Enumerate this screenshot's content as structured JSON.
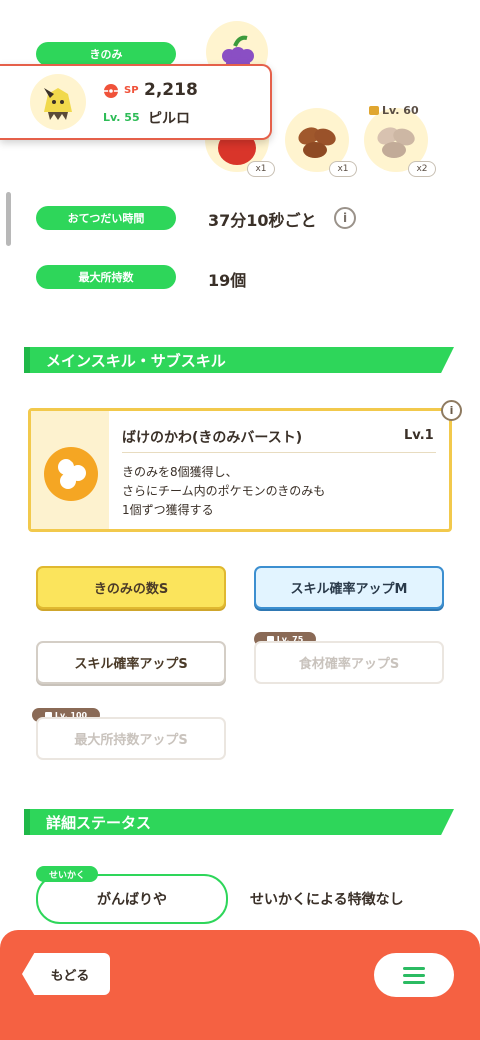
{
  "berry_section": {
    "label": "きのみ",
    "ingredients": [
      {
        "icon": "tomato-icon",
        "qty": "x1"
      },
      {
        "icon": "cacao-icon",
        "qty": "x1"
      },
      {
        "icon": "mushroom-icon",
        "qty": "x2",
        "lock_level": "Lv. 60"
      }
    ],
    "berry_icon": "grape-berry-icon"
  },
  "pokemon": {
    "sp_label": "SP",
    "sp_value": "2,218",
    "level": "Lv. 55",
    "name": "ピルロ"
  },
  "help_row": {
    "label": "おてつだい時間",
    "value": "37分10秒ごと"
  },
  "capacity_row": {
    "label": "最大所持数",
    "value": "19個"
  },
  "skills_section": {
    "title": "メインスキル・サブスキル"
  },
  "main_skill": {
    "name": "ばけのかわ(きのみバースト)",
    "level": "Lv.1",
    "description_lines": [
      "きのみを8個獲得し、",
      "さらにチーム内のポケモンのきのみも",
      "1個ずつ獲得する"
    ]
  },
  "sub_skills": [
    {
      "label": "きのみの数S",
      "style": "gold"
    },
    {
      "label": "スキル確率アップM",
      "style": "blue"
    },
    {
      "label": "スキル確率アップS",
      "style": "white"
    },
    {
      "label": "食材確率アップS",
      "style": "locked",
      "lock_level": "Lv. 75"
    },
    {
      "label": "最大所持数アップS",
      "style": "locked",
      "lock_level": "Lv. 100"
    }
  ],
  "details_section": {
    "title": "詳細ステータス"
  },
  "nature": {
    "tag": "せいかく",
    "value": "がんばりや",
    "effect": "せいかくによる特徴なし"
  },
  "bottom_bar": {
    "back_label": "もどる"
  },
  "colors": {
    "accent_green": "#2ed65a",
    "bottom_bar": "#f56142",
    "gold": "#fbe45c",
    "blue": "#e2f4ff"
  }
}
